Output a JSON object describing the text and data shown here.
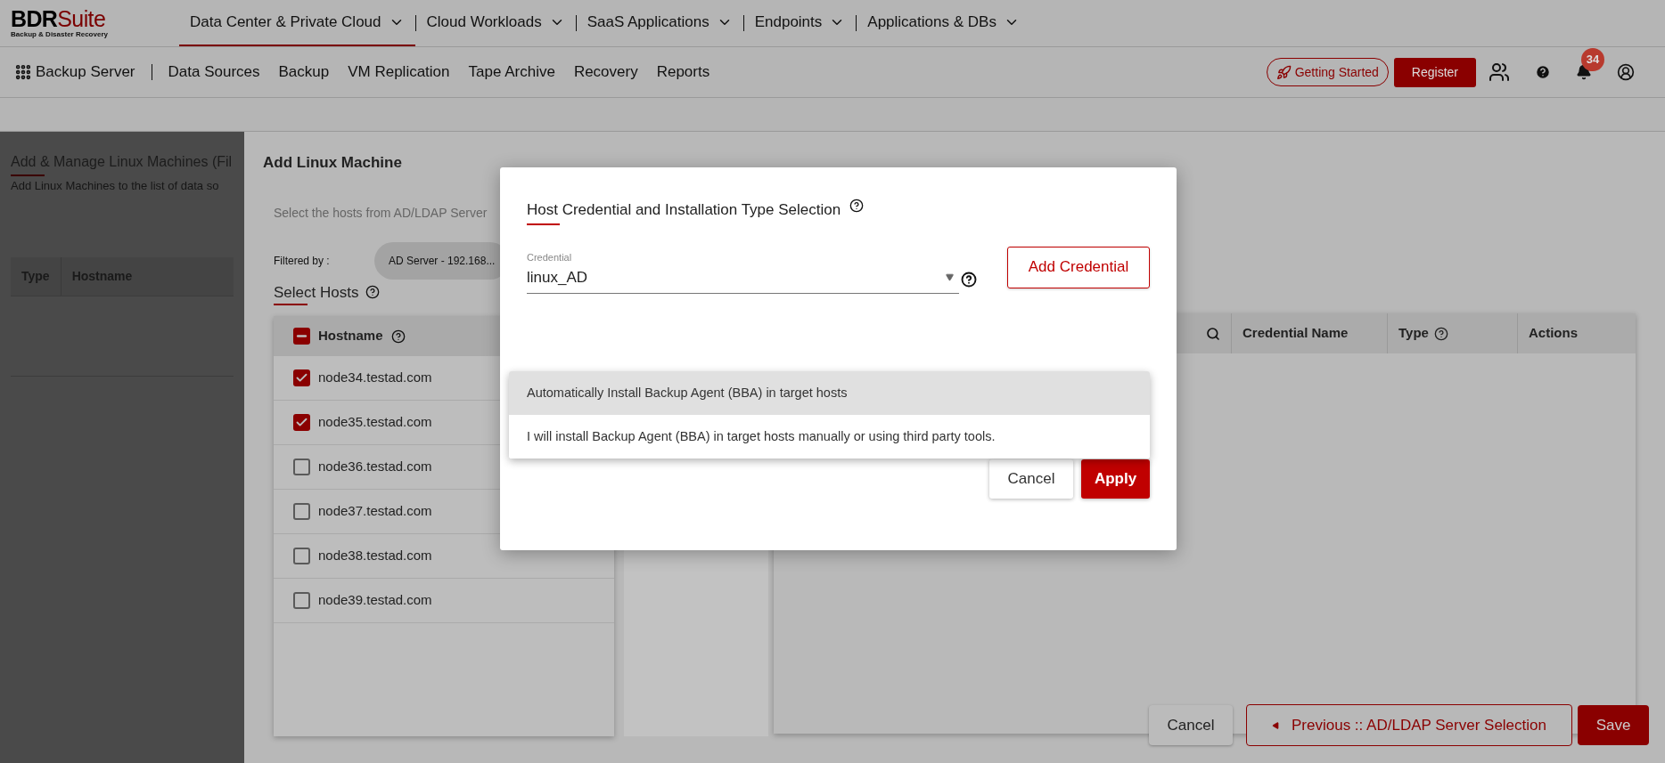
{
  "logo": {
    "primary": "BDR",
    "accent": "Suite",
    "tagline": "Backup & Disaster Recovery"
  },
  "main_nav": [
    {
      "label": "Data Center & Private Cloud",
      "selected": true
    },
    {
      "label": "Cloud Workloads",
      "selected": false
    },
    {
      "label": "SaaS Applications",
      "selected": false
    },
    {
      "label": "Endpoints",
      "selected": false
    },
    {
      "label": "Applications & DBs",
      "selected": false
    }
  ],
  "product": {
    "label": "Backup Server"
  },
  "sub_nav": [
    "Data Sources",
    "Backup",
    "VM Replication",
    "Tape Archive",
    "Recovery",
    "Reports"
  ],
  "header_actions": {
    "getting_started": "Getting Started",
    "register": "Register",
    "notifications_badge": "34"
  },
  "page": {
    "title": "Add & Manage Linux Machines (Fil",
    "subtitle": "Add Linux Machines to the list of data so",
    "table_columns": [
      "Type",
      "Hostname"
    ]
  },
  "panel": {
    "title": "Add Linux Machine",
    "instruction": "Select the hosts from AD/LDAP Server",
    "filter_label": "Filtered by :",
    "filter_chip": "AD Server - 192.168...",
    "section_title": "Select Hosts",
    "hosts_header": {
      "label": "Hostname",
      "indeterminate": true
    },
    "hosts": [
      {
        "name": "node34.testad.com",
        "checked": true
      },
      {
        "name": "node35.testad.com",
        "checked": true
      },
      {
        "name": "node36.testad.com",
        "checked": false
      },
      {
        "name": "node37.testad.com",
        "checked": false
      },
      {
        "name": "node38.testad.com",
        "checked": false
      },
      {
        "name": "node39.testad.com",
        "checked": false
      }
    ],
    "credential_columns": [
      {
        "label": "Credential Name",
        "help": false
      },
      {
        "label": "Type",
        "help": true
      },
      {
        "label": "Actions",
        "help": false
      }
    ],
    "buttons": {
      "cancel": "Cancel",
      "previous": "Previous :: AD/LDAP Server Selection",
      "save": "Save"
    }
  },
  "dialog": {
    "title": "Host Credential and Installation Type Selection",
    "credential": {
      "label": "Credential",
      "value": "linux_AD"
    },
    "add_credential": "Add Credential",
    "install_options": [
      {
        "label": "Automatically Install Backup Agent (BBA) in target hosts",
        "selected": true
      },
      {
        "label": "I will install Backup Agent (BBA) in target hosts manually or using third party tools.",
        "selected": false
      }
    ],
    "cancel": "Cancel",
    "apply": "Apply"
  }
}
